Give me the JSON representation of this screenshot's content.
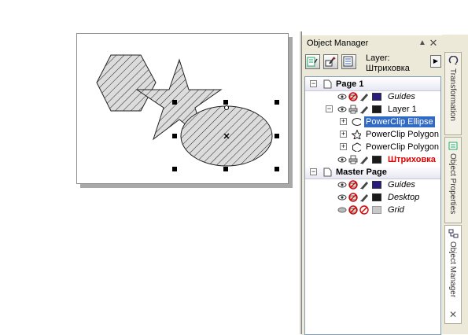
{
  "docker": {
    "title": "Object Manager",
    "layer_label": "Layer:",
    "layer_name": "Штриховка"
  },
  "tree": {
    "page1": {
      "label": "Page 1"
    },
    "guides1": {
      "label": "Guides",
      "color": "#2a1c7e"
    },
    "layer1": {
      "label": "Layer 1",
      "color": "#1a1a1a"
    },
    "obj_ellipse": {
      "label": "PowerClip Ellipse"
    },
    "obj_polygon1": {
      "label": "PowerClip Polygon"
    },
    "obj_polygon2": {
      "label": "PowerClip Polygon"
    },
    "shtrikh": {
      "label": "Штриховка",
      "color": "#1a1a1a"
    },
    "master": {
      "label": "Master Page"
    },
    "guides2": {
      "label": "Guides",
      "color": "#2a1c7e"
    },
    "desktop": {
      "label": "Desktop",
      "color": "#1a1a1a"
    },
    "grid": {
      "label": "Grid",
      "color": "#c8c8c8"
    }
  },
  "side_tabs": [
    "Transformation",
    "Object Properties",
    "Object Manager"
  ],
  "colors": {
    "selection": "#316ac5",
    "active_layer_text": "#e00000",
    "docker_bg": "#ece9d8"
  }
}
